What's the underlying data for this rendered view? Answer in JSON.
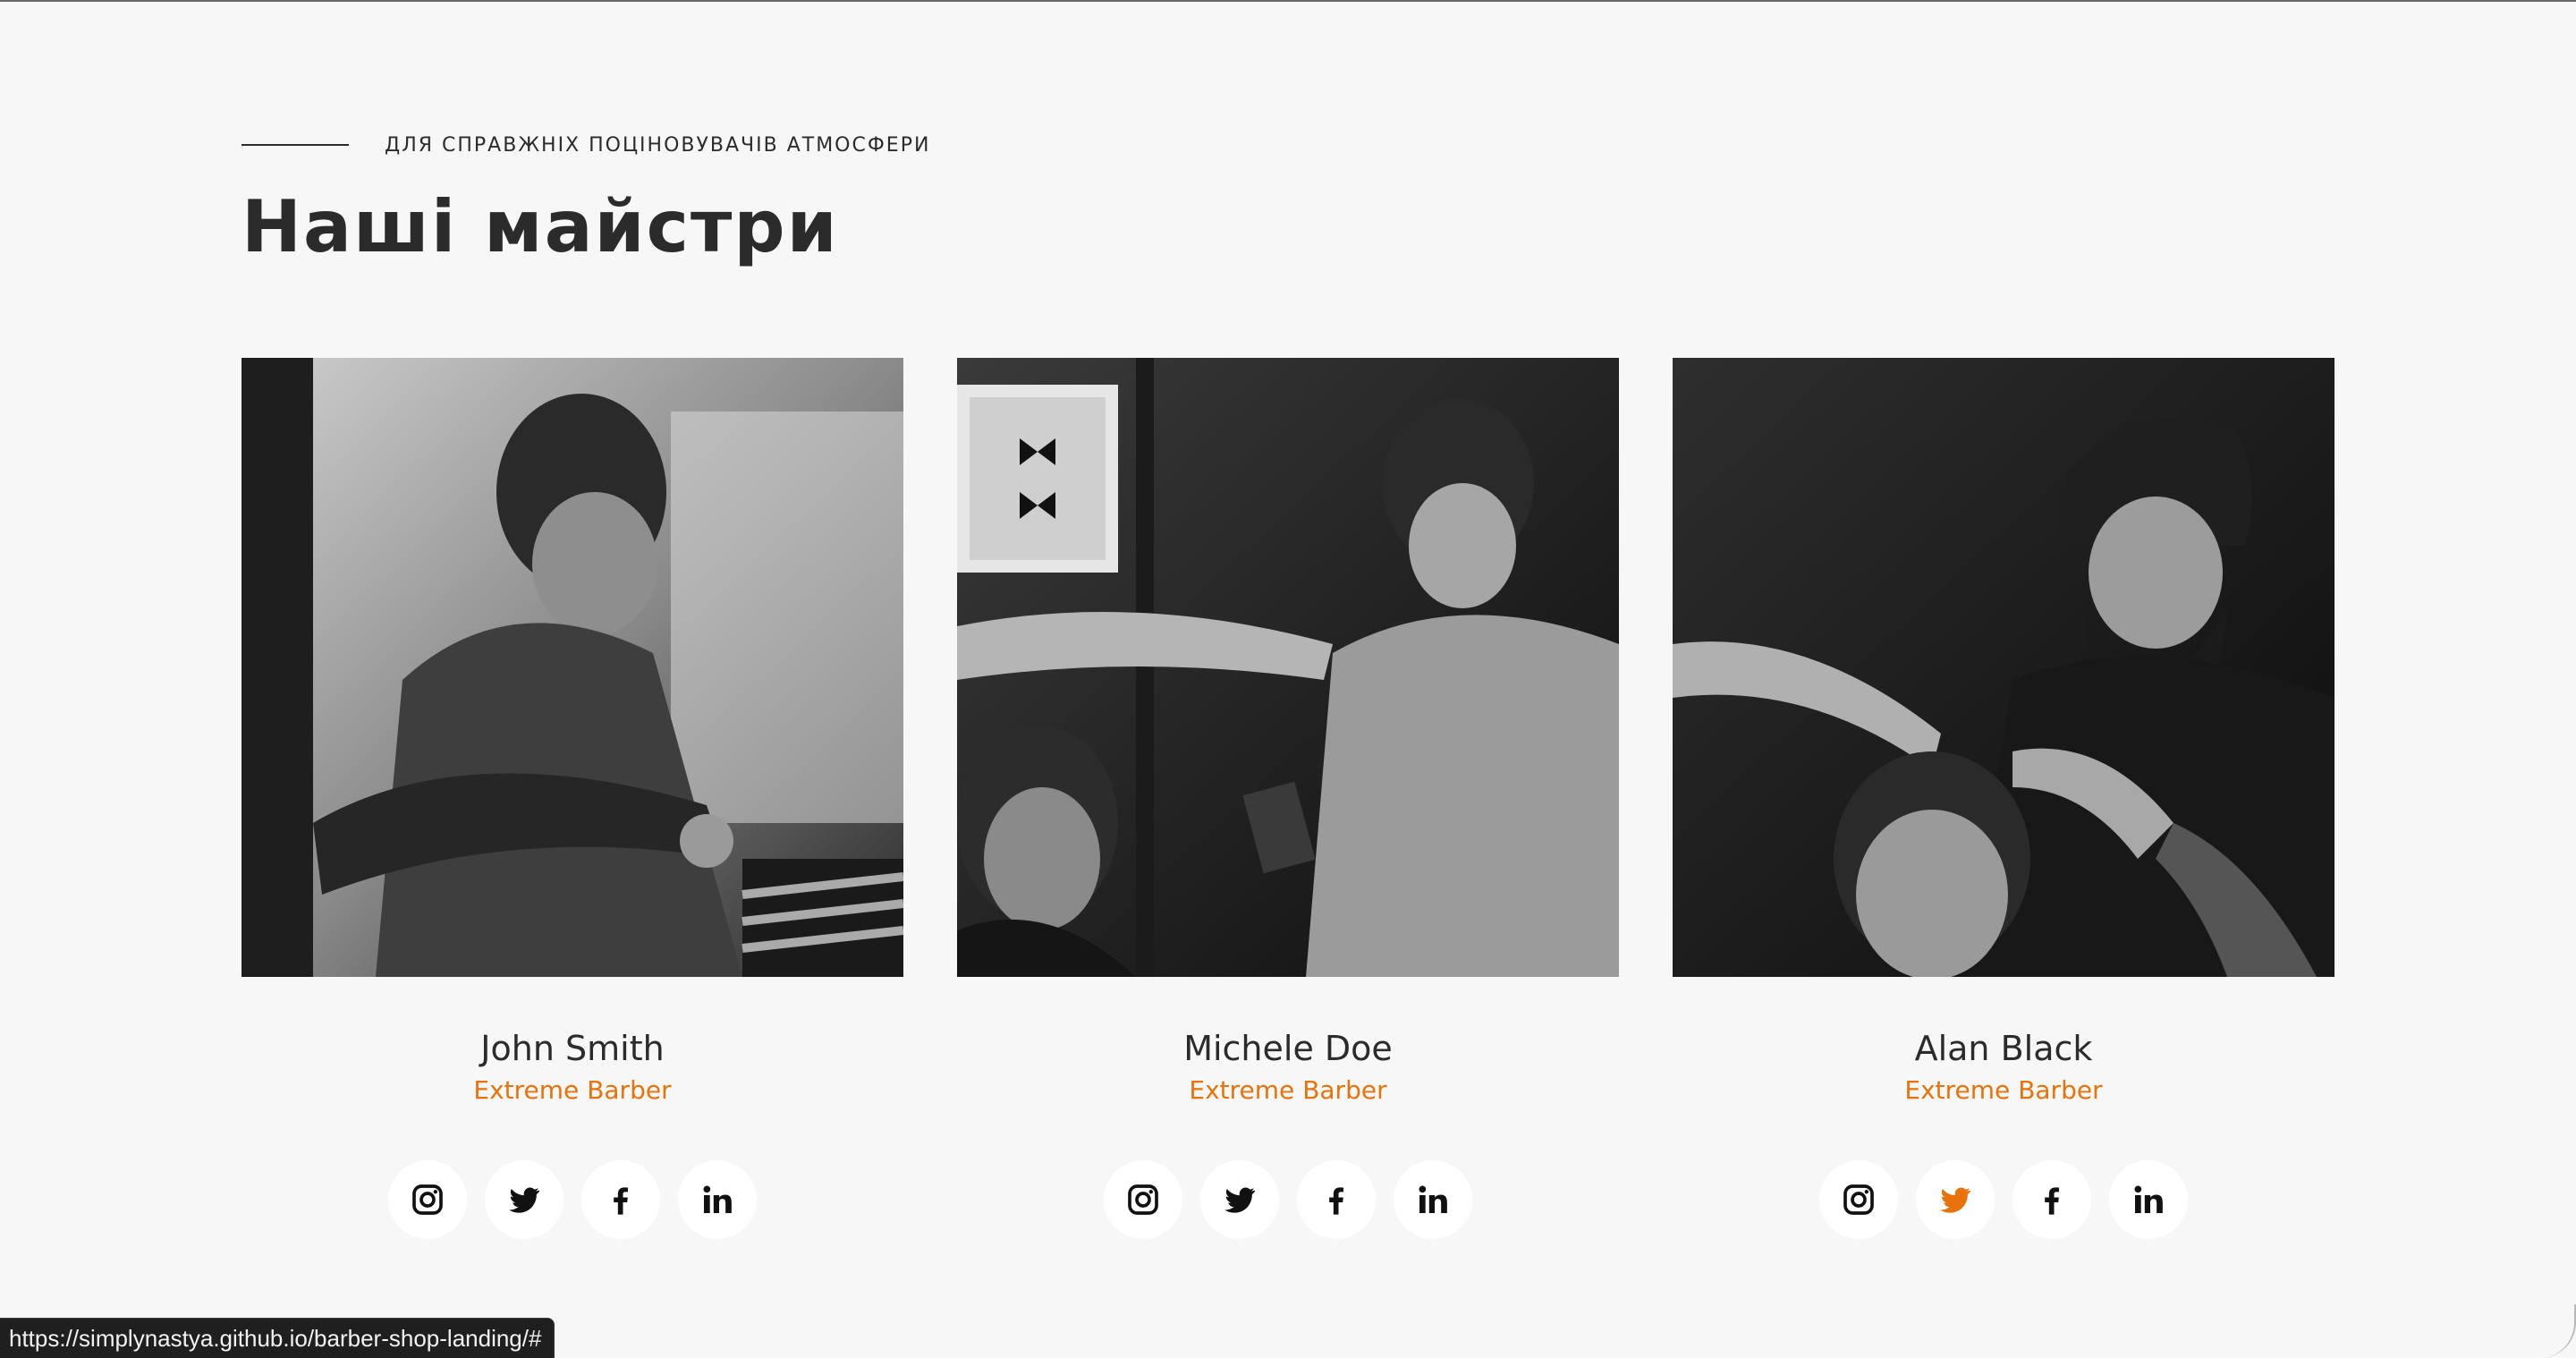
{
  "section": {
    "eyebrow": "ДЛЯ СПРАВЖНІХ ПОЦІНОВУВАЧІВ АТМОСФЕРИ",
    "title": "Наші майстри"
  },
  "barbers": [
    {
      "name": "John Smith",
      "role": "Extreme Barber",
      "socials": [
        "instagram-icon",
        "twitter-icon",
        "facebook-icon",
        "linkedin-icon"
      ],
      "active_social": ""
    },
    {
      "name": "Michele Doe",
      "role": "Extreme Barber",
      "socials": [
        "instagram-icon",
        "twitter-icon",
        "facebook-icon",
        "linkedin-icon"
      ],
      "active_social": ""
    },
    {
      "name": "Alan Black",
      "role": "Extreme Barber",
      "socials": [
        "instagram-icon",
        "twitter-icon",
        "facebook-icon",
        "linkedin-icon"
      ],
      "active_social": "twitter-icon"
    }
  ],
  "status_bar": {
    "url": "https://simplynastya.github.io/barber-shop-landing/#"
  },
  "colors": {
    "background": "#f7f7f7",
    "text": "#2b2b2b",
    "accent": "#e8720c",
    "icon": "#111111",
    "icon_bg": "#ffffff"
  }
}
